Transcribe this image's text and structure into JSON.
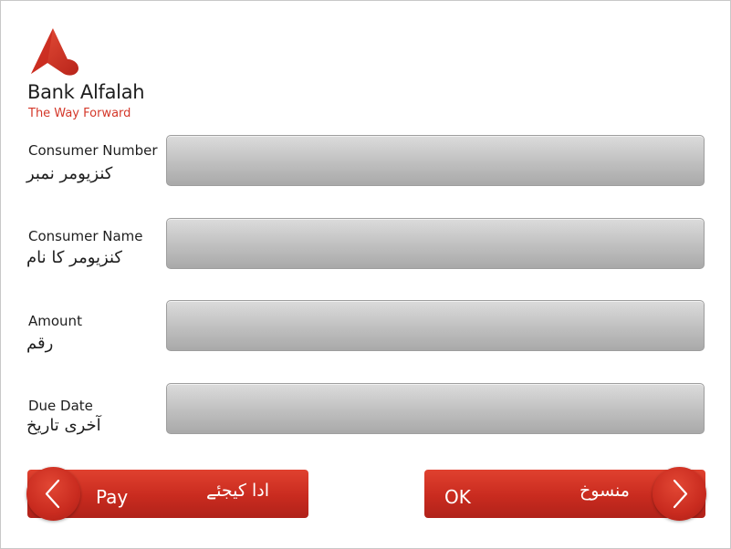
{
  "brand": {
    "name": "Bank Alfalah",
    "tagline": "The Way Forward",
    "colors": {
      "primary_red": "#d4382a",
      "dark_red": "#b0221a"
    }
  },
  "form": {
    "fields": [
      {
        "label_en": "Consumer Number",
        "label_ur": "کنزیومر نمبر",
        "value": ""
      },
      {
        "label_en": "Consumer Name",
        "label_ur": "کنزیومر کا نام",
        "value": ""
      },
      {
        "label_en": "Amount",
        "label_ur": "رقم",
        "value": ""
      },
      {
        "label_en": "Due Date",
        "label_ur": "آخری تاریخ",
        "value": ""
      }
    ]
  },
  "buttons": {
    "pay": {
      "label_en": "Pay",
      "label_ur": "ادا کیجئے",
      "icon": "chevron-left-icon"
    },
    "ok": {
      "label_en": "OK",
      "label_ur": "منسوخ",
      "icon": "chevron-right-icon"
    }
  }
}
